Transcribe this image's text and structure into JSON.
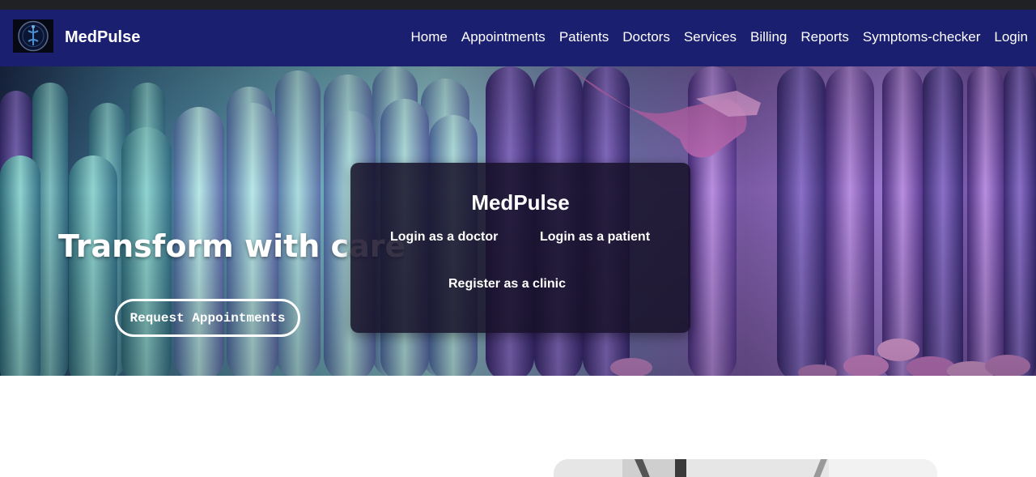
{
  "brand": {
    "name": "MedPulse"
  },
  "nav": {
    "links": [
      "Home",
      "Appointments",
      "Patients",
      "Doctors",
      "Services",
      "Billing",
      "Reports",
      "Symptoms-checker",
      "Login"
    ]
  },
  "hero": {
    "title": "Transform with care",
    "request_button": "Request Appointments"
  },
  "login_modal": {
    "title": "MedPulse",
    "login_doctor": "Login as a doctor",
    "login_patient": "Login as a patient",
    "register_clinic": "Register as a clinic"
  },
  "colors": {
    "navbar_bg": "#1a1f70",
    "modal_bg": "#161028",
    "text": "#ffffff"
  }
}
